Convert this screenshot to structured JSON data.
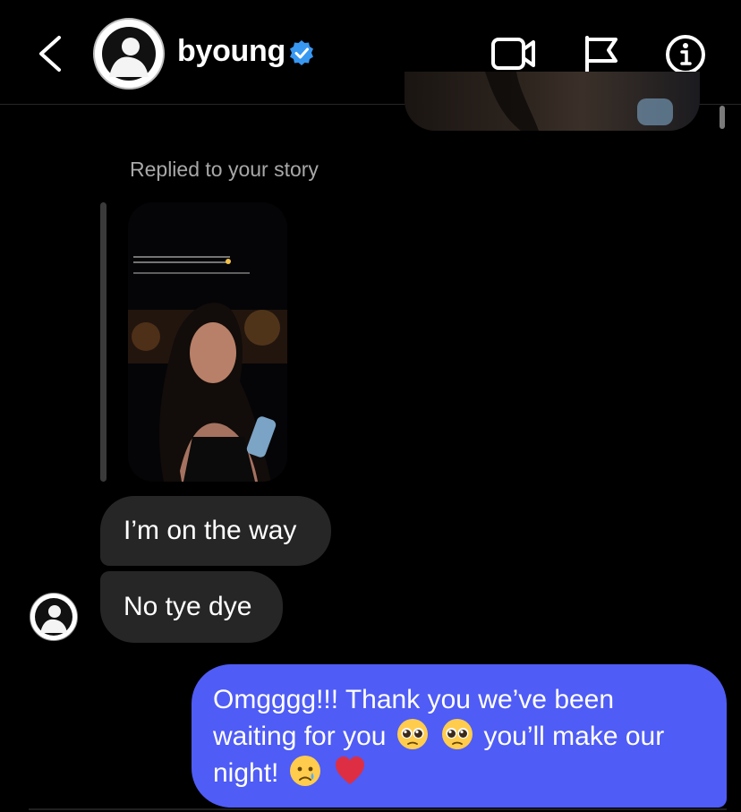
{
  "header": {
    "username": "byoung",
    "icons": [
      "back-chevron-icon",
      "avatar",
      "verified-badge-icon",
      "video-call-icon",
      "flag-icon",
      "info-icon"
    ]
  },
  "chat": {
    "story_reply_label": "Replied to your story",
    "received": [
      {
        "text": "I’m on the way"
      },
      {
        "text": "No tye dye"
      }
    ],
    "sent": {
      "line1": "Omgggg!!! Thank you we’ve been",
      "line2_a": "waiting for you",
      "line2_b": "you’ll make our",
      "line3": "night!",
      "emojis": [
        "pleading-face",
        "pleading-face",
        "crying-face",
        "red-heart"
      ]
    }
  },
  "colors": {
    "background": "#000000",
    "received_bubble": "#262626",
    "sent_bubble": "#4f5cf5",
    "verified": "#3897f0",
    "secondary_text": "#a8a8a8"
  }
}
